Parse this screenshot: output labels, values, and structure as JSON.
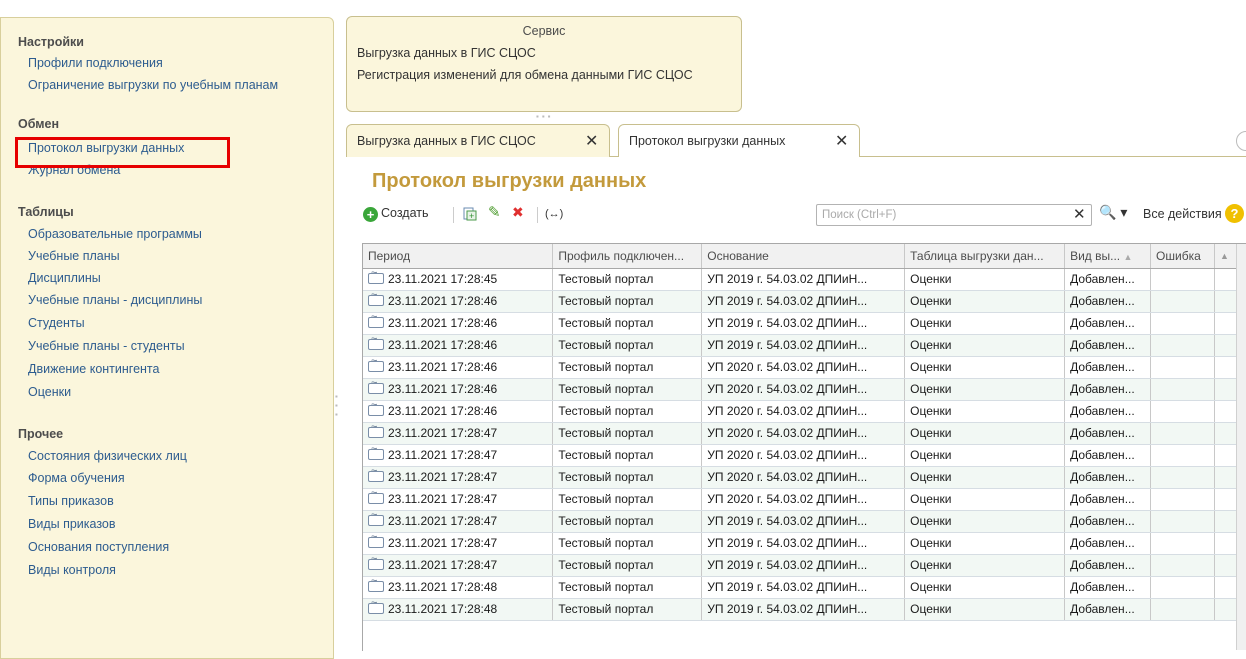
{
  "sidebar": {
    "sections": [
      {
        "title": "Настройки",
        "items": [
          "Профили подключения",
          "Ограничение выгрузки по учебным планам"
        ]
      },
      {
        "title": "Обмен",
        "items": [
          "Протокол выгрузки данных",
          "Журнал обмена"
        ]
      },
      {
        "title": "Таблицы",
        "items": [
          "Образовательные программы",
          "Учебные планы",
          "Дисциплины",
          "Учебные планы - дисциплины",
          "Студенты",
          "Учебные планы - студенты",
          "Движение контингента",
          "Оценки"
        ]
      },
      {
        "title": "Прочее",
        "items": [
          "Состояния физических лиц",
          "Форма обучения",
          "Типы приказов",
          "Виды приказов",
          "Основания поступления",
          "Виды контроля"
        ]
      }
    ]
  },
  "service": {
    "title": "Сервис",
    "items": [
      "Выгрузка данных в ГИС СЦОС",
      "Регистрация изменений для обмена данными ГИС СЦОС"
    ]
  },
  "tabs": [
    {
      "label": "Выгрузка данных в ГИС СЦОС",
      "close": "✕"
    },
    {
      "label": "Протокол выгрузки данных",
      "close": "✕"
    }
  ],
  "form": {
    "title": "Протокол выгрузки данных"
  },
  "toolbar": {
    "create_label": "Создать",
    "create_icon": "+",
    "copy_icon": "copy-icon",
    "edit_icon": "✎",
    "delete_icon": "✖",
    "link_icon": "(↔)",
    "search_placeholder": "Поиск (Ctrl+F)",
    "search_clear": "✕",
    "search_button": "🔍 ▾",
    "all_actions_label": "Все действия ▾",
    "help_label": "?"
  },
  "table": {
    "columns": [
      "Период",
      "Профиль подключен...",
      "Основание",
      "Таблица выгрузки дан...",
      "Вид вы...",
      "Ошибка"
    ],
    "rows": [
      [
        "23.11.2021 17:28:45",
        "Тестовый портал",
        "УП 2019 г. 54.03.02 ДПИиН...",
        "Оценки",
        "Добавлен...",
        ""
      ],
      [
        "23.11.2021 17:28:46",
        "Тестовый портал",
        "УП 2019 г. 54.03.02 ДПИиН...",
        "Оценки",
        "Добавлен...",
        ""
      ],
      [
        "23.11.2021 17:28:46",
        "Тестовый портал",
        "УП 2019 г. 54.03.02 ДПИиН...",
        "Оценки",
        "Добавлен...",
        ""
      ],
      [
        "23.11.2021 17:28:46",
        "Тестовый портал",
        "УП 2019 г. 54.03.02 ДПИиН...",
        "Оценки",
        "Добавлен...",
        ""
      ],
      [
        "23.11.2021 17:28:46",
        "Тестовый портал",
        "УП 2020 г. 54.03.02 ДПИиН...",
        "Оценки",
        "Добавлен...",
        ""
      ],
      [
        "23.11.2021 17:28:46",
        "Тестовый портал",
        "УП 2020 г. 54.03.02 ДПИиН...",
        "Оценки",
        "Добавлен...",
        ""
      ],
      [
        "23.11.2021 17:28:46",
        "Тестовый портал",
        "УП 2020 г. 54.03.02 ДПИиН...",
        "Оценки",
        "Добавлен...",
        ""
      ],
      [
        "23.11.2021 17:28:47",
        "Тестовый портал",
        "УП 2020 г. 54.03.02 ДПИиН...",
        "Оценки",
        "Добавлен...",
        ""
      ],
      [
        "23.11.2021 17:28:47",
        "Тестовый портал",
        "УП 2020 г. 54.03.02 ДПИиН...",
        "Оценки",
        "Добавлен...",
        ""
      ],
      [
        "23.11.2021 17:28:47",
        "Тестовый портал",
        "УП 2020 г. 54.03.02 ДПИиН...",
        "Оценки",
        "Добавлен...",
        ""
      ],
      [
        "23.11.2021 17:28:47",
        "Тестовый портал",
        "УП 2020 г. 54.03.02 ДПИиН...",
        "Оценки",
        "Добавлен...",
        ""
      ],
      [
        "23.11.2021 17:28:47",
        "Тестовый портал",
        "УП 2019 г. 54.03.02 ДПИиН...",
        "Оценки",
        "Добавлен...",
        ""
      ],
      [
        "23.11.2021 17:28:47",
        "Тестовый портал",
        "УП 2019 г. 54.03.02 ДПИиН...",
        "Оценки",
        "Добавлен...",
        ""
      ],
      [
        "23.11.2021 17:28:47",
        "Тестовый портал",
        "УП 2019 г. 54.03.02 ДПИиН...",
        "Оценки",
        "Добавлен...",
        ""
      ],
      [
        "23.11.2021 17:28:48",
        "Тестовый портал",
        "УП 2019 г. 54.03.02 ДПИиН...",
        "Оценки",
        "Добавлен...",
        ""
      ],
      [
        "23.11.2021 17:28:48",
        "Тестовый портал",
        "УП 2019 г. 54.03.02 ДПИиН...",
        "Оценки",
        "Добавлен...",
        ""
      ]
    ]
  }
}
